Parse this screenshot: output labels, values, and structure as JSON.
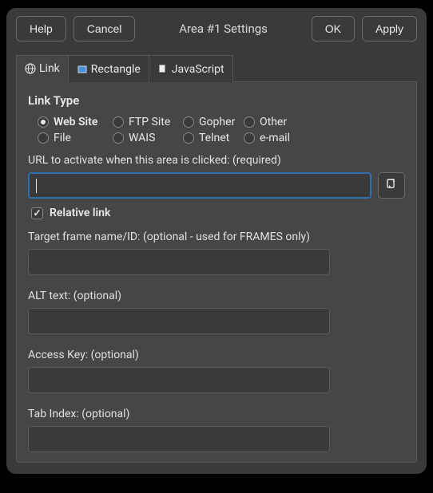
{
  "buttons": {
    "help": "Help",
    "cancel": "Cancel",
    "ok": "OK",
    "apply": "Apply"
  },
  "title": "Area #1 Settings",
  "tabs": {
    "link": "Link",
    "rectangle": "Rectangle",
    "javascript": "JavaScript"
  },
  "section": {
    "link_type": "Link Type"
  },
  "radios": {
    "website": "Web Site",
    "ftp": "FTP Site",
    "gopher": "Gopher",
    "other": "Other",
    "file": "File",
    "wais": "WAIS",
    "telnet": "Telnet",
    "email": "e-mail"
  },
  "labels": {
    "url": "URL to activate when this area is clicked: (required)",
    "relative": "Relative link",
    "target": "Target frame name/ID: (optional - used for FRAMES only)",
    "alt": "ALT text: (optional)",
    "accesskey": "Access Key: (optional)",
    "tabindex": "Tab Index: (optional)"
  },
  "values": {
    "url": "",
    "target": "",
    "alt": "",
    "accesskey": "",
    "tabindex": ""
  },
  "icons": {
    "globe": "globe-icon",
    "rectangle": "rectangle-icon",
    "script": "script-icon",
    "open": "open-file-icon"
  }
}
